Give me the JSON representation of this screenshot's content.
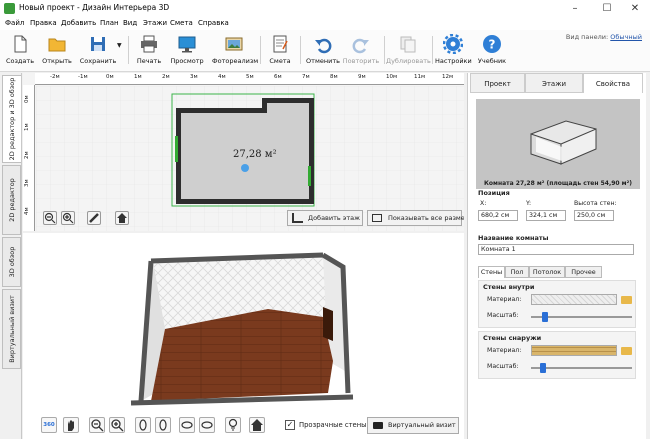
{
  "window": {
    "title": "Новый проект - Дизайн Интерьера 3D",
    "controls": [
      "–",
      "☐",
      "✕"
    ]
  },
  "menu": [
    "Файл",
    "Правка",
    "Добавить",
    "План",
    "Вид",
    "Этажи",
    "Смета",
    "Справка"
  ],
  "toolbar": {
    "buttons": [
      {
        "label": "Создать",
        "icon": "new-file-icon"
      },
      {
        "label": "Открыть",
        "icon": "folder-open-icon"
      },
      {
        "label": "Сохранить",
        "icon": "floppy-save-icon"
      },
      {
        "label": "Печать",
        "icon": "printer-icon"
      },
      {
        "label": "Просмотр",
        "icon": "monitor-preview-icon"
      },
      {
        "label": "Фотореализм",
        "icon": "photo-realism-icon"
      },
      {
        "label": "Смета",
        "icon": "estimate-notepad-icon"
      },
      {
        "label": "Отменить",
        "icon": "undo-arrow-icon"
      },
      {
        "label": "Повторить",
        "icon": "redo-arrow-icon",
        "disabled": true
      },
      {
        "label": "Дублировать",
        "icon": "duplicate-icon",
        "disabled": true
      },
      {
        "label": "Настройки",
        "icon": "gear-icon"
      },
      {
        "label": "Учебник",
        "icon": "help-question-icon"
      }
    ],
    "panel_view_label": "Вид панели:",
    "panel_view_value": "Обычный"
  },
  "left_tabs": [
    "2D редактор и 3D обзор",
    "2D редактор",
    "3D обзор",
    "Виртуальный визит"
  ],
  "plan": {
    "ruler_top": [
      "-2м",
      "-1м",
      "0м",
      "1м",
      "2м",
      "3м",
      "4м",
      "5м",
      "6м",
      "7м",
      "8м",
      "9м",
      "10м",
      "11м",
      "12м"
    ],
    "ruler_left": [
      "0м",
      "1м",
      "2м",
      "3м",
      "4м"
    ],
    "room_area": "27,28 м²",
    "add_floor_label": "Добавить этаж",
    "show_sizes_label": "Показывать все размеры"
  },
  "view3d": {
    "transparent_walls_label": "Прозрачные стены",
    "transparent_walls_checked": true,
    "virtual_visit_label": "Виртуальный визит",
    "rotate_label": "360"
  },
  "right_panel": {
    "tabs": [
      "Проект",
      "Этажи",
      "Свойства"
    ],
    "active_tab": "Свойства",
    "preview_caption": "Комната 27,28 м²  (площадь стен 54,90 м²)",
    "position_title": "Позиция",
    "x_label": "X:",
    "x_value": "680,2 см",
    "y_label": "Y:",
    "y_value": "324,1 см",
    "height_label": "Высота стен:",
    "height_value": "250,0 см",
    "room_name_title": "Название комнаты",
    "room_name_value": "Комната 1",
    "sub_tabs": [
      "Стены",
      "Пол",
      "Потолок",
      "Прочее"
    ],
    "inner_walls_title": "Стены внутри",
    "outer_walls_title": "Стены снаружи",
    "material_label": "Материал:",
    "scale_label": "Масштаб:",
    "inner_scale": 0.12,
    "outer_scale": 0.09
  },
  "colors": {
    "accent": "#2a6fd6",
    "plan_room": "#cfcfcf",
    "floor": "#7a3a1e"
  }
}
